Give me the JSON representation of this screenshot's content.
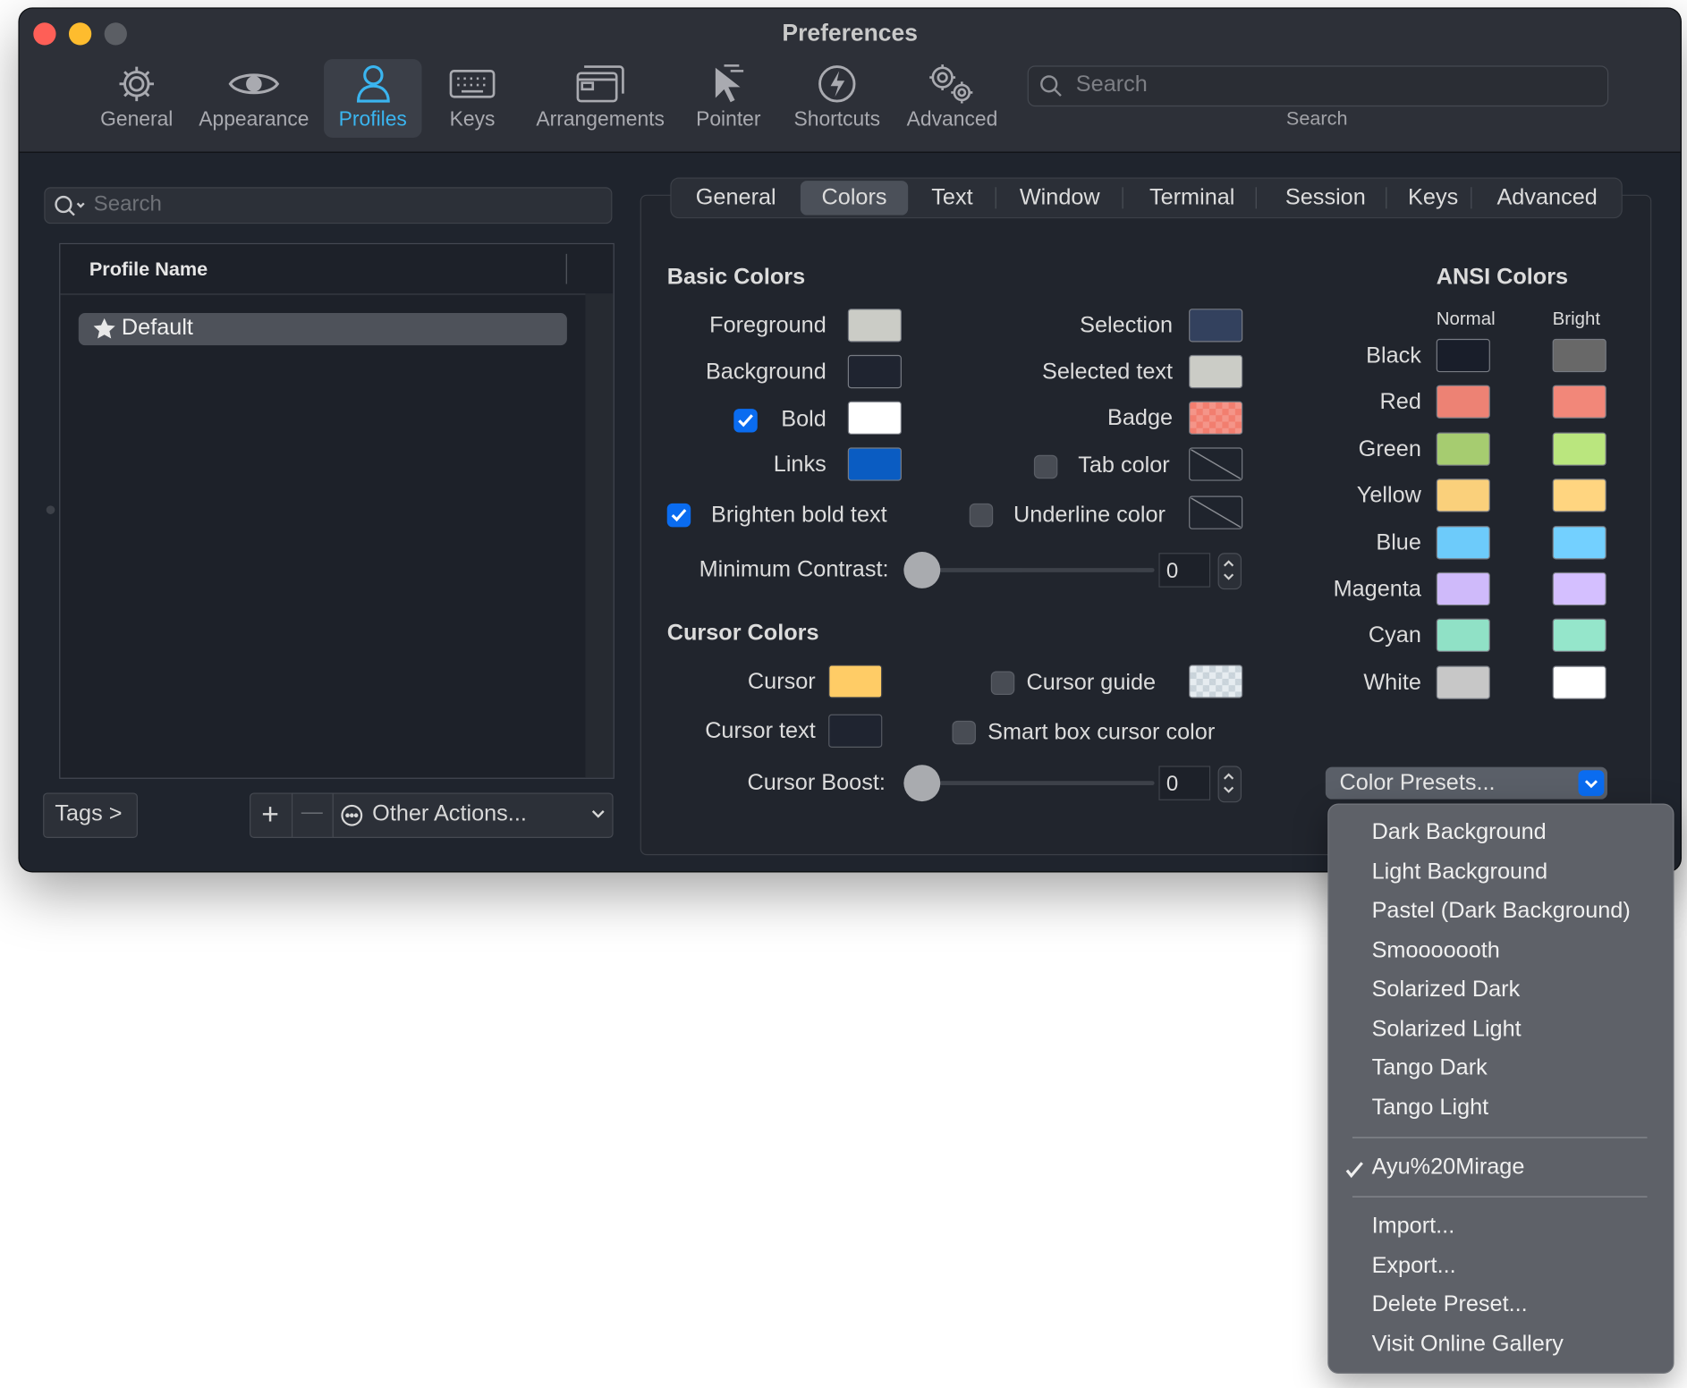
{
  "window": {
    "title": "Preferences"
  },
  "toolbar": {
    "items": [
      {
        "label": "General",
        "icon": "gear-icon"
      },
      {
        "label": "Appearance",
        "icon": "eye-icon"
      },
      {
        "label": "Profiles",
        "icon": "person-icon",
        "active": true
      },
      {
        "label": "Keys",
        "icon": "keyboard-icon"
      },
      {
        "label": "Arrangements",
        "icon": "windows-icon"
      },
      {
        "label": "Pointer",
        "icon": "pointer-icon"
      },
      {
        "label": "Shortcuts",
        "icon": "bolt-icon"
      },
      {
        "label": "Advanced",
        "icon": "gears-icon"
      }
    ],
    "search_placeholder": "Search",
    "search_label": "Search"
  },
  "profiles": {
    "search_placeholder": "Search",
    "column_header": "Profile Name",
    "items": [
      {
        "name": "Default",
        "starred": true,
        "selected": true
      }
    ],
    "tags_button": "Tags >",
    "add_button": "+",
    "remove_button": "—",
    "other_actions": "Other Actions..."
  },
  "tabs": [
    "General",
    "Colors",
    "Text",
    "Window",
    "Terminal",
    "Session",
    "Keys",
    "Advanced"
  ],
  "active_tab": "Colors",
  "basic_colors": {
    "heading": "Basic Colors",
    "foreground": {
      "label": "Foreground",
      "color": "#cbccc6"
    },
    "background": {
      "label": "Background",
      "color": "#1f2430"
    },
    "bold": {
      "label": "Bold",
      "color": "#ffffff",
      "checked": true
    },
    "links": {
      "label": "Links",
      "color": "#0a5cc2"
    },
    "selection": {
      "label": "Selection",
      "color": "#33415e"
    },
    "selected_text": {
      "label": "Selected text",
      "color": "#cbccc6"
    },
    "badge": {
      "label": "Badge",
      "color": "#f27e6f"
    },
    "tab_color": {
      "label": "Tab color",
      "checked": false
    },
    "brighten_bold": {
      "label": "Brighten bold text",
      "checked": true
    },
    "underline_color": {
      "label": "Underline color",
      "checked": false
    },
    "min_contrast": {
      "label": "Minimum Contrast:",
      "value": "0"
    }
  },
  "cursor_colors": {
    "heading": "Cursor Colors",
    "cursor": {
      "label": "Cursor",
      "color": "#ffcc66"
    },
    "cursor_text": {
      "label": "Cursor text",
      "color": "#1f2430"
    },
    "cursor_guide": {
      "label": "Cursor guide",
      "checked": false
    },
    "smart_box": {
      "label": "Smart box cursor color",
      "checked": false
    },
    "cursor_boost": {
      "label": "Cursor Boost:",
      "value": "0"
    }
  },
  "ansi": {
    "heading": "ANSI Colors",
    "normal_label": "Normal",
    "bright_label": "Bright",
    "rows": [
      {
        "name": "Black",
        "normal": "#191e2a",
        "bright": "#686868"
      },
      {
        "name": "Red",
        "normal": "#ed8274",
        "bright": "#f28779"
      },
      {
        "name": "Green",
        "normal": "#a6cc70",
        "bright": "#bae67e"
      },
      {
        "name": "Yellow",
        "normal": "#fad07b",
        "bright": "#ffd580"
      },
      {
        "name": "Blue",
        "normal": "#6dcbfa",
        "bright": "#73d0ff"
      },
      {
        "name": "Magenta",
        "normal": "#cfbafa",
        "bright": "#d4bfff"
      },
      {
        "name": "Cyan",
        "normal": "#90e1c6",
        "bright": "#95e6cb"
      },
      {
        "name": "White",
        "normal": "#c7c7c7",
        "bright": "#ffffff"
      }
    ]
  },
  "presets": {
    "button_label": "Color Presets...",
    "builtin": [
      "Dark Background",
      "Light Background",
      "Pastel (Dark Background)",
      "Smooooooth",
      "Solarized Dark",
      "Solarized Light",
      "Tango Dark",
      "Tango Light"
    ],
    "custom": [
      {
        "name": "Ayu%20Mirage",
        "checked": true
      }
    ],
    "actions": [
      "Import...",
      "Export...",
      "Delete Preset...",
      "Visit Online Gallery"
    ]
  }
}
